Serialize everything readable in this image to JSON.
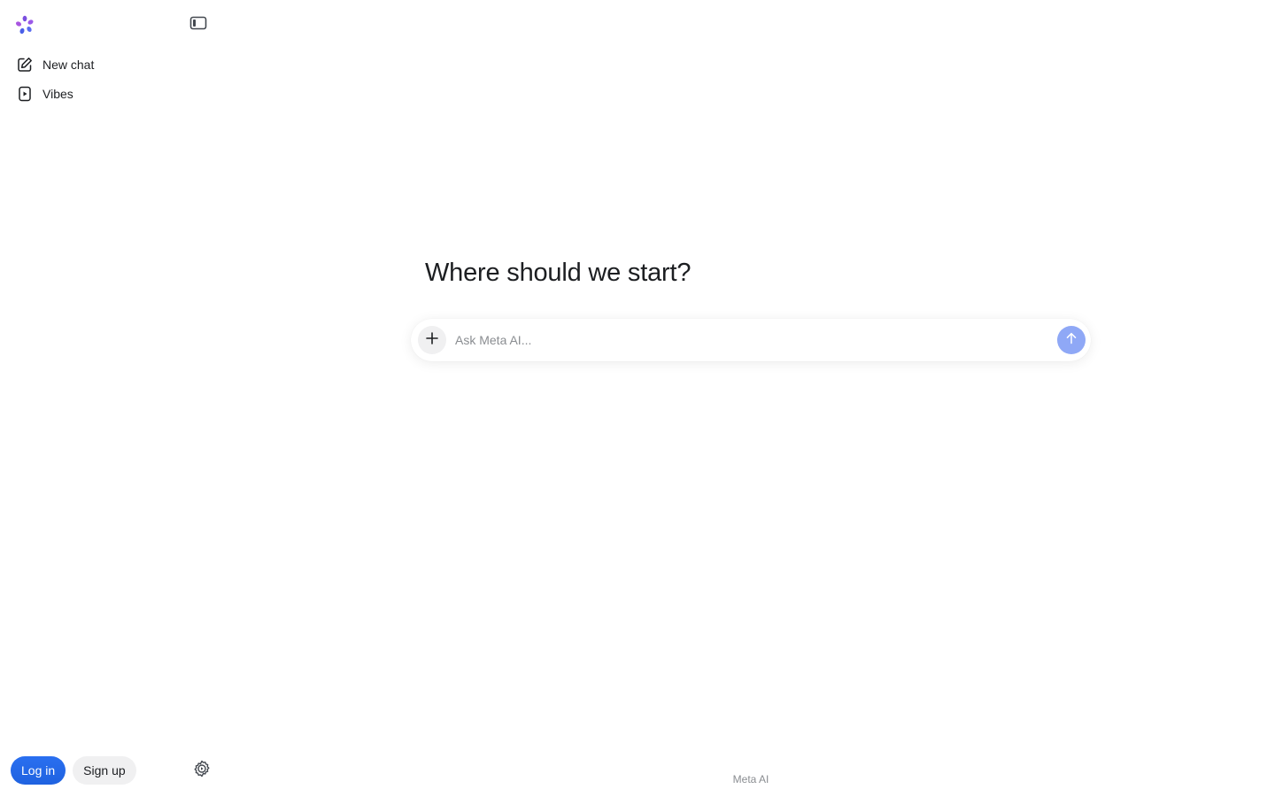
{
  "sidebar": {
    "logo_icon": "meta-ai-logo-icon",
    "collapse_icon": "sidebar-collapse-icon",
    "items": [
      {
        "label": "New chat",
        "icon": "edit-pencil-icon"
      },
      {
        "label": "Vibes",
        "icon": "play-video-icon"
      }
    ],
    "login_label": "Log in",
    "signup_label": "Sign up",
    "settings_icon": "gear-icon"
  },
  "main": {
    "headline": "Where should we start?",
    "composer": {
      "placeholder": "Ask Meta AI...",
      "add_icon": "plus-icon",
      "send_icon": "arrow-up-icon"
    },
    "footer_brand": "Meta AI"
  },
  "colors": {
    "login_button": "#2a6ff0",
    "send_button": "#8fa8f6",
    "logo_primary": "#7b4fe0"
  }
}
